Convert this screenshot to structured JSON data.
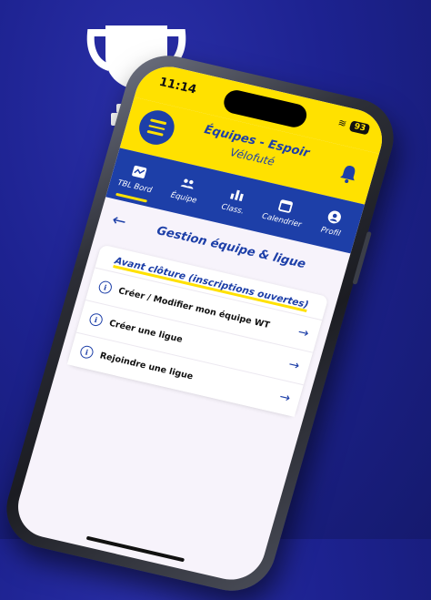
{
  "status": {
    "time": "11:14",
    "battery": "93"
  },
  "appbar": {
    "title": "Équipes - Espoir",
    "subtitle": "Vélofuté"
  },
  "tabs": [
    {
      "label": "TBL Bord",
      "icon": "dashboard-icon",
      "active": true
    },
    {
      "label": "Équipe",
      "icon": "team-icon",
      "active": false
    },
    {
      "label": "Class.",
      "icon": "ranking-icon",
      "active": false
    },
    {
      "label": "Calendrier",
      "icon": "calendar-icon",
      "active": false
    },
    {
      "label": "Profil",
      "icon": "profile-icon",
      "active": false
    }
  ],
  "page": {
    "title": "Gestion équipe & ligue"
  },
  "section": {
    "title": "Avant clôture (inscriptions ouvertes)"
  },
  "items": [
    {
      "label": "Créer / Modifier mon équipe WT"
    },
    {
      "label": "Créer une ligue"
    },
    {
      "label": "Rejoindre une ligue"
    }
  ],
  "colors": {
    "primary": "#1d3fa8",
    "accent": "#ffe100",
    "background": "#1d2290"
  }
}
